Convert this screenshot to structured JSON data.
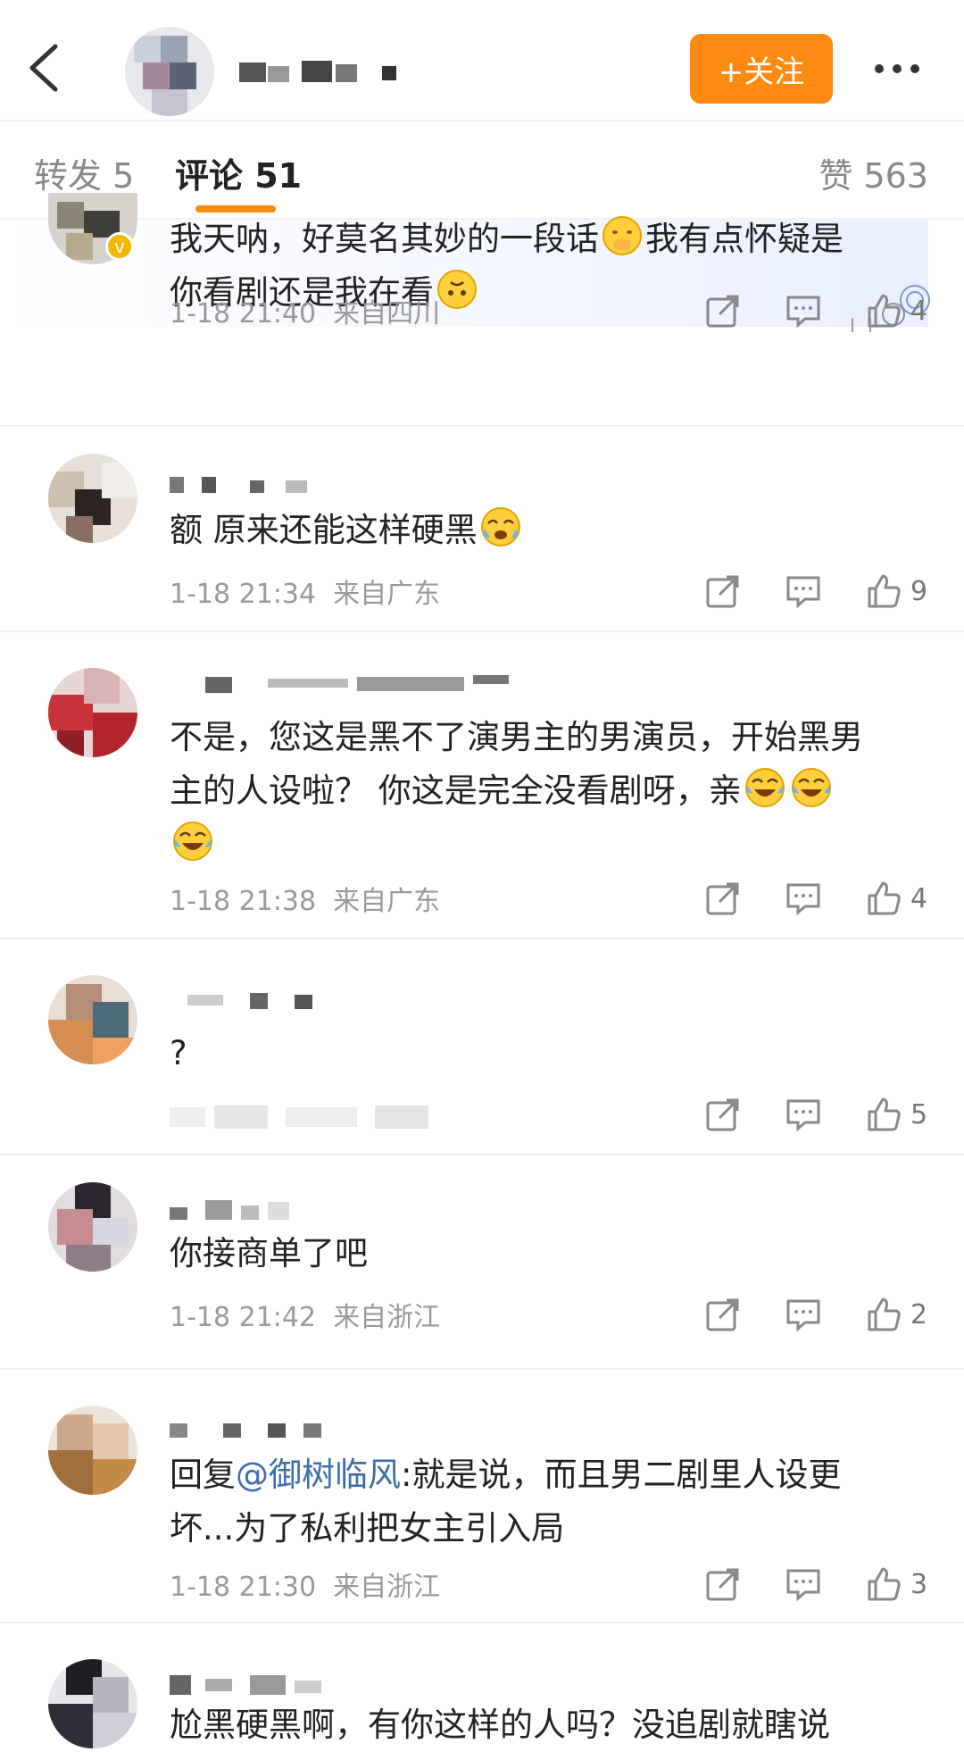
{
  "header": {
    "follow_label": "+关注",
    "accent_color": "#ff8a11"
  },
  "tabs": {
    "repost_label": "转发 5",
    "comment_label": "评论 51",
    "likes_label": "赞 563"
  },
  "comments": [
    {
      "text_1": "我天呐，好莫名其妙的一段话",
      "text_2": "我有点怀疑是",
      "text_3": "你看剧还是我在看",
      "time": "1-18 21:40",
      "location": "来自四川",
      "likes": "4"
    },
    {
      "text_1": "额 原来还能这样硬黑",
      "time": "1-18 21:34",
      "location": "来自广东",
      "likes": "9"
    },
    {
      "text_1": "不是，您这是黑不了演男主的男演员，开始黑男",
      "text_2": "主的人设啦？ 你这是完全没看剧呀，亲",
      "time": "1-18 21:38",
      "location": "来自广东",
      "likes": "4"
    },
    {
      "text_1": "?",
      "likes": "5"
    },
    {
      "text_1": "你接商单了吧",
      "time": "1-18 21:42",
      "location": "来自浙江",
      "likes": "2"
    },
    {
      "reply_prefix": "回复",
      "mention": "@御树临风",
      "text_1": ":就是说，而且男二剧里人设更",
      "text_2": "坏...为了私利把女主引入局",
      "time": "1-18 21:30",
      "location": "来自浙江",
      "likes": "3"
    },
    {
      "text_1": "尬黑硬黑啊，有你这样的人吗？没追剧就瞎说"
    }
  ]
}
